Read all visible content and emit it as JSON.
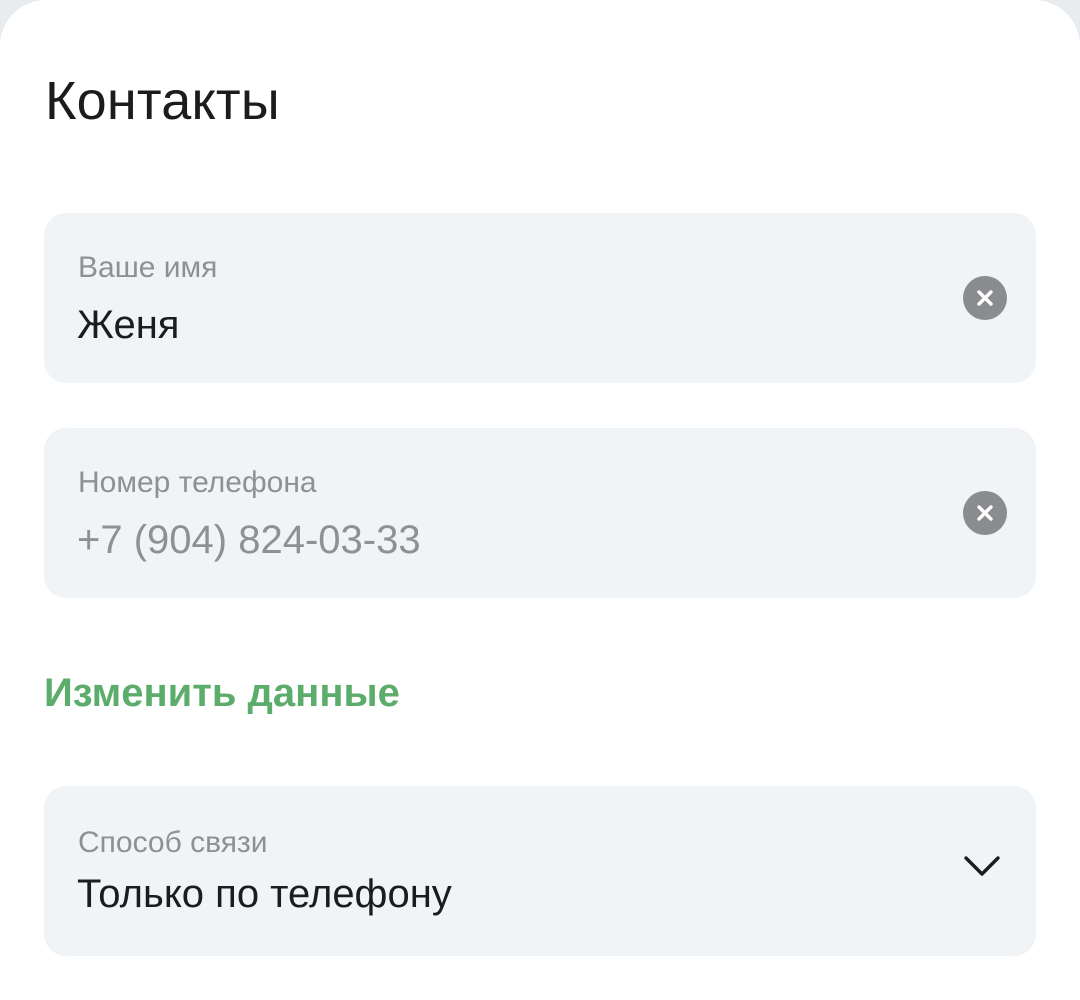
{
  "section": {
    "title": "Контакты"
  },
  "name_field": {
    "label": "Ваше имя",
    "value": "Женя",
    "clear_icon": "clear-circle-icon"
  },
  "phone_field": {
    "label": "Номер телефона",
    "value": "+7 (904) 824-03-33",
    "clear_icon": "clear-circle-icon"
  },
  "edit_link": {
    "label": "Изменить данные",
    "color": "#5cad6b"
  },
  "contact_method": {
    "label": "Способ связи",
    "selected": "Только по телефону",
    "icon": "chevron-down-icon"
  },
  "colors": {
    "field_background": "#f1f4f7",
    "accent": "#5cad6b",
    "text_primary": "#1c1c1e",
    "text_secondary": "#8e9094",
    "clear_icon": "#8b8c8f"
  }
}
